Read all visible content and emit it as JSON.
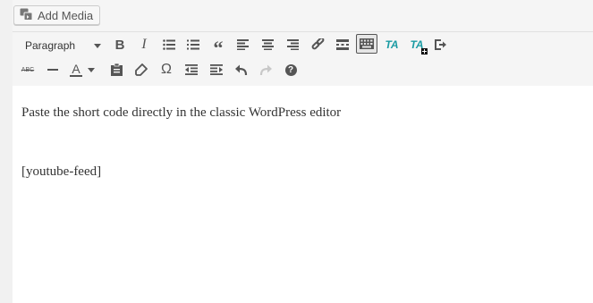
{
  "media": {
    "add_media_label": "Add Media"
  },
  "toolbar": {
    "format_select_value": "Paragraph",
    "bold_label": "B",
    "italic_label": "I",
    "blockquote_label": "“",
    "strikethrough_label": "ABC",
    "text_color_label": "A",
    "special_char_label": "Ω",
    "help_label": "?",
    "ta_label": "TA",
    "ta2_label": "TA"
  },
  "content": {
    "paragraphs": [
      "Paste the short code directly in the classic WordPress editor",
      "[youtube-feed]"
    ]
  },
  "colors": {
    "accent_teal": "#1a9ba3",
    "text": "#333333",
    "icon": "#555555"
  }
}
